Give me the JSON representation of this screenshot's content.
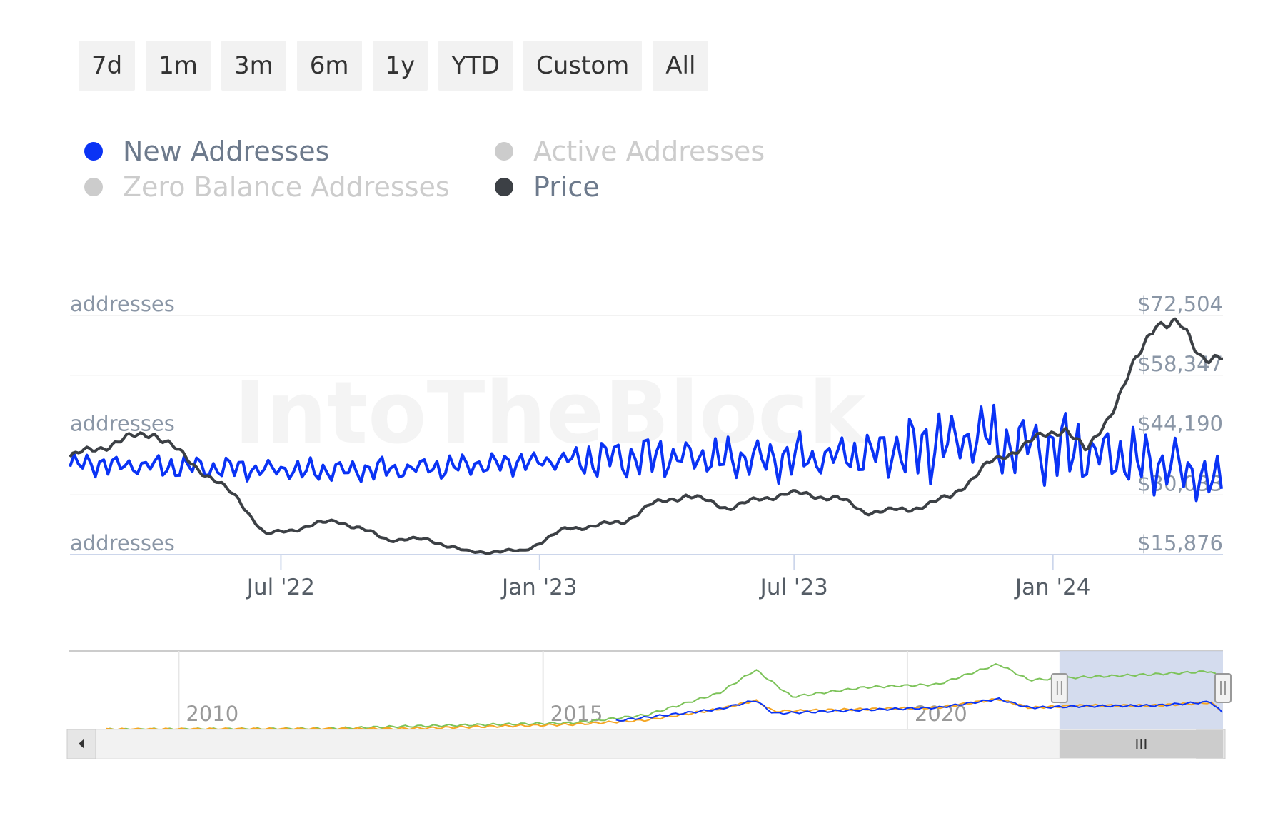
{
  "range_selector": {
    "buttons": [
      "7d",
      "1m",
      "3m",
      "6m",
      "1y",
      "YTD",
      "Custom",
      "All"
    ]
  },
  "legend": {
    "items": [
      {
        "label": "New Addresses",
        "color": "#0a33f5",
        "enabled": true
      },
      {
        "label": "Active Addresses",
        "color": "#cccccc",
        "enabled": false
      },
      {
        "label": "Zero Balance Addresses",
        "color": "#cccccc",
        "enabled": false
      },
      {
        "label": "Price",
        "color": "#3c4045",
        "enabled": true
      }
    ]
  },
  "watermark": "IntoTheBlock",
  "colors": {
    "new_addresses": "#0a33f5",
    "price": "#3c4045",
    "grid": "#e6e6e6",
    "axis_text": "#8a96a6",
    "navigator_mask": "#ccd6eb",
    "nav_green": "#7dc35a",
    "nav_orange": "#f5a623",
    "nav_blue": "#0a33f5"
  },
  "chart_data": [
    {
      "type": "line",
      "x_ticks": [
        "Jul '22",
        "Jan '23",
        "Jul '23",
        "Jan '24"
      ],
      "x_range": [
        "2022-02-01",
        "2024-05-01"
      ],
      "left_axis_labels": [
        "addresses",
        "addresses",
        "addresses"
      ],
      "right_axis_ticks": [
        "$72,504",
        "$58,347",
        "$44,190",
        "$30,033",
        "$15,876"
      ],
      "right_axis_range": [
        15876,
        72504
      ],
      "series": [
        {
          "name": "New Addresses",
          "axis": "left",
          "relative_level": [
            {
              "x": "2022-02-01",
              "y": 0.38
            },
            {
              "x": "2022-04-01",
              "y": 0.37
            },
            {
              "x": "2022-06-01",
              "y": 0.36
            },
            {
              "x": "2022-08-01",
              "y": 0.35
            },
            {
              "x": "2022-10-01",
              "y": 0.36
            },
            {
              "x": "2022-12-01",
              "y": 0.38
            },
            {
              "x": "2023-02-01",
              "y": 0.4
            },
            {
              "x": "2023-04-01",
              "y": 0.41
            },
            {
              "x": "2023-06-01",
              "y": 0.4
            },
            {
              "x": "2023-08-01",
              "y": 0.41
            },
            {
              "x": "2023-10-01",
              "y": 0.45
            },
            {
              "x": "2023-11-10",
              "y": 0.5
            },
            {
              "x": "2023-12-01",
              "y": 0.46
            },
            {
              "x": "2024-01-01",
              "y": 0.45
            },
            {
              "x": "2024-02-15",
              "y": 0.41
            },
            {
              "x": "2024-03-15",
              "y": 0.38
            },
            {
              "x": "2024-04-15",
              "y": 0.33
            },
            {
              "x": "2024-05-01",
              "y": 0.29
            }
          ]
        },
        {
          "name": "Price",
          "axis": "right",
          "values": [
            {
              "x": "2022-02-01",
              "y": 39000
            },
            {
              "x": "2022-03-01",
              "y": 42000
            },
            {
              "x": "2022-04-01",
              "y": 45000
            },
            {
              "x": "2022-05-01",
              "y": 37000
            },
            {
              "x": "2022-06-01",
              "y": 29000
            },
            {
              "x": "2022-06-20",
              "y": 20500
            },
            {
              "x": "2022-08-10",
              "y": 24000
            },
            {
              "x": "2022-09-15",
              "y": 19500
            },
            {
              "x": "2022-10-15",
              "y": 19400
            },
            {
              "x": "2022-11-10",
              "y": 16500
            },
            {
              "x": "2022-12-20",
              "y": 16700
            },
            {
              "x": "2023-01-20",
              "y": 22000
            },
            {
              "x": "2023-03-01",
              "y": 23500
            },
            {
              "x": "2023-03-20",
              "y": 27500
            },
            {
              "x": "2023-04-15",
              "y": 30000
            },
            {
              "x": "2023-05-15",
              "y": 27000
            },
            {
              "x": "2023-06-25",
              "y": 30500
            },
            {
              "x": "2023-08-01",
              "y": 29300
            },
            {
              "x": "2023-08-20",
              "y": 26000
            },
            {
              "x": "2023-09-20",
              "y": 26500
            },
            {
              "x": "2023-10-20",
              "y": 29500
            },
            {
              "x": "2023-11-15",
              "y": 37000
            },
            {
              "x": "2023-12-15",
              "y": 42500
            },
            {
              "x": "2024-01-10",
              "y": 46000
            },
            {
              "x": "2024-01-25",
              "y": 40000
            },
            {
              "x": "2024-02-15",
              "y": 52000
            },
            {
              "x": "2024-03-01",
              "y": 62000
            },
            {
              "x": "2024-03-14",
              "y": 71500
            },
            {
              "x": "2024-04-01",
              "y": 69500
            },
            {
              "x": "2024-04-15",
              "y": 63500
            },
            {
              "x": "2024-05-01",
              "y": 62000
            },
            {
              "x": "2024-05-05",
              "y": 64000
            },
            {
              "x": "2024-05-15",
              "y": 66000
            }
          ]
        }
      ]
    },
    {
      "type": "line",
      "role": "navigator",
      "x_ticks": [
        "2010",
        "2015",
        "2020"
      ],
      "x_range": [
        "2008-07-01",
        "2024-05-01"
      ],
      "selected_range": [
        "2022-02-01",
        "2024-05-01"
      ],
      "series": [
        {
          "color": "#7dc35a",
          "relative_level": [
            {
              "x": "2009-01-01",
              "y": 0.0
            },
            {
              "x": "2012-01-01",
              "y": 0.01
            },
            {
              "x": "2013-01-01",
              "y": 0.04
            },
            {
              "x": "2014-06-01",
              "y": 0.07
            },
            {
              "x": "2015-06-01",
              "y": 0.09
            },
            {
              "x": "2016-06-01",
              "y": 0.2
            },
            {
              "x": "2017-06-01",
              "y": 0.5
            },
            {
              "x": "2017-12-01",
              "y": 0.82
            },
            {
              "x": "2018-06-01",
              "y": 0.45
            },
            {
              "x": "2019-06-01",
              "y": 0.58
            },
            {
              "x": "2020-06-01",
              "y": 0.62
            },
            {
              "x": "2021-04-01",
              "y": 0.9
            },
            {
              "x": "2021-09-01",
              "y": 0.68
            },
            {
              "x": "2022-06-01",
              "y": 0.72
            },
            {
              "x": "2023-06-01",
              "y": 0.76
            },
            {
              "x": "2024-03-01",
              "y": 0.8
            },
            {
              "x": "2024-05-01",
              "y": 0.68
            }
          ]
        },
        {
          "color": "#f5a623",
          "relative_level": [
            {
              "x": "2009-01-01",
              "y": 0.0
            },
            {
              "x": "2013-01-01",
              "y": 0.01
            },
            {
              "x": "2015-06-01",
              "y": 0.07
            },
            {
              "x": "2016-06-01",
              "y": 0.13
            },
            {
              "x": "2017-06-01",
              "y": 0.28
            },
            {
              "x": "2017-12-01",
              "y": 0.4
            },
            {
              "x": "2018-03-01",
              "y": 0.25
            },
            {
              "x": "2019-06-01",
              "y": 0.28
            },
            {
              "x": "2020-06-01",
              "y": 0.3
            },
            {
              "x": "2021-04-01",
              "y": 0.42
            },
            {
              "x": "2021-09-01",
              "y": 0.3
            },
            {
              "x": "2022-06-01",
              "y": 0.33
            },
            {
              "x": "2023-06-01",
              "y": 0.33
            },
            {
              "x": "2024-03-01",
              "y": 0.37
            },
            {
              "x": "2024-05-01",
              "y": 0.24
            }
          ]
        },
        {
          "color": "#0a33f5",
          "relative_level": [
            {
              "x": "2016-01-01",
              "y": 0.12
            },
            {
              "x": "2017-06-01",
              "y": 0.28
            },
            {
              "x": "2017-12-01",
              "y": 0.4
            },
            {
              "x": "2018-03-01",
              "y": 0.22
            },
            {
              "x": "2019-06-01",
              "y": 0.27
            },
            {
              "x": "2020-06-01",
              "y": 0.3
            },
            {
              "x": "2021-04-01",
              "y": 0.42
            },
            {
              "x": "2021-09-01",
              "y": 0.3
            },
            {
              "x": "2022-06-01",
              "y": 0.32
            },
            {
              "x": "2023-06-01",
              "y": 0.33
            },
            {
              "x": "2024-03-01",
              "y": 0.38
            },
            {
              "x": "2024-05-01",
              "y": 0.22
            }
          ]
        }
      ]
    }
  ]
}
